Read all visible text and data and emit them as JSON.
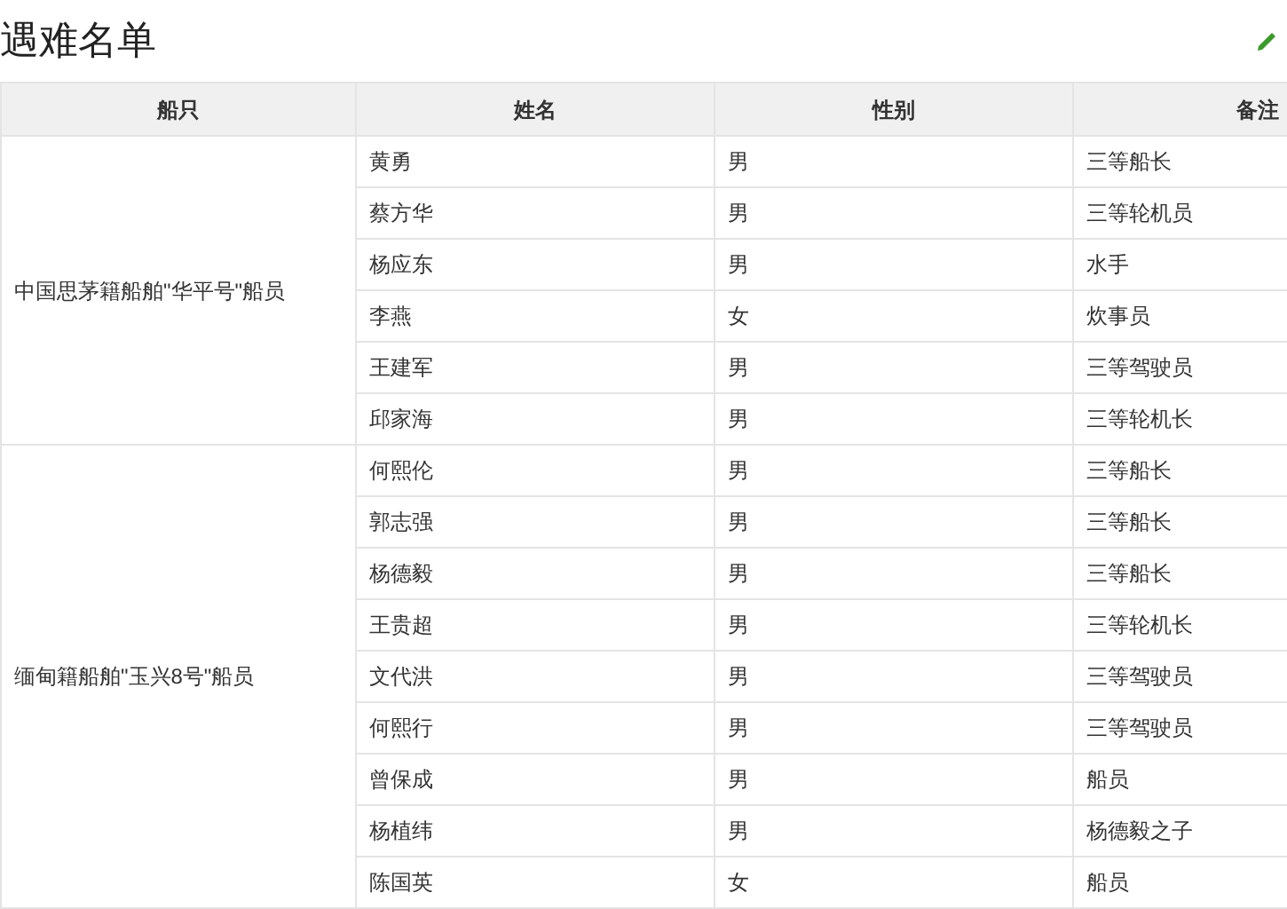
{
  "title": "遇难名单",
  "table": {
    "columns": [
      "船只",
      "姓名",
      "性别",
      "备注"
    ],
    "groups": [
      {
        "ship": "中国思茅籍船舶\"华平号\"船员",
        "crew": [
          {
            "name": "黄勇",
            "gender": "男",
            "note": "三等船长"
          },
          {
            "name": "蔡方华",
            "gender": "男",
            "note": "三等轮机员"
          },
          {
            "name": "杨应东",
            "gender": "男",
            "note": "水手"
          },
          {
            "name": "李燕",
            "gender": "女",
            "note": "炊事员"
          },
          {
            "name": "王建军",
            "gender": "男",
            "note": "三等驾驶员"
          },
          {
            "name": "邱家海",
            "gender": "男",
            "note": "三等轮机长"
          }
        ]
      },
      {
        "ship": "缅甸籍船舶\"玉兴8号\"船员",
        "crew": [
          {
            "name": "何熙伦",
            "gender": "男",
            "note": "三等船长"
          },
          {
            "name": "郭志强",
            "gender": "男",
            "note": "三等船长"
          },
          {
            "name": "杨德毅",
            "gender": "男",
            "note": "三等船长"
          },
          {
            "name": "王贵超",
            "gender": "男",
            "note": "三等轮机长"
          },
          {
            "name": "文代洪",
            "gender": "男",
            "note": "三等驾驶员"
          },
          {
            "name": "何熙行",
            "gender": "男",
            "note": "三等驾驶员"
          },
          {
            "name": "曾保成",
            "gender": "男",
            "note": "船员"
          },
          {
            "name": "杨植纬",
            "gender": "男",
            "note": "杨德毅之子"
          },
          {
            "name": "陈国英",
            "gender": "女",
            "note": "船员"
          }
        ]
      }
    ]
  }
}
